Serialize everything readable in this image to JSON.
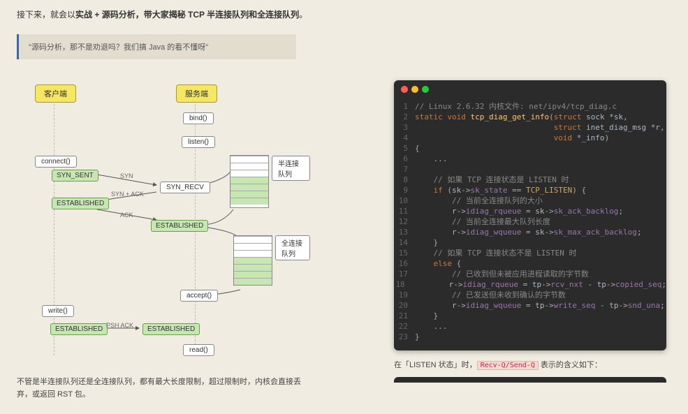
{
  "intro": {
    "prefix": "接下来，就会以",
    "emphasis": "实战 + 源码分析，带大家揭秘 TCP 半连接队列和全连接队列",
    "suffix": "。"
  },
  "quote": "\"源码分析，那不是劝退吗？我们搞 Java 的看不懂呀\"",
  "diagram": {
    "client": "客户端",
    "server": "服务端",
    "bind": "bind()",
    "listen": "listen()",
    "connect": "connect()",
    "syn_sent": "SYN_SENT",
    "syn_recv": "SYN_RECV",
    "established1": "ESTABLISHED",
    "established2": "ESTABLISHED",
    "established3": "ESTABLISHED",
    "established4": "ESTABLISHED",
    "accept": "accept()",
    "write": "write()",
    "read": "read()",
    "half_queue": "半连接队列",
    "full_queue": "全连接队列",
    "syn": "SYN",
    "synack": "SYN + ACK",
    "ack": "ACK",
    "pshack": "PSH ACK"
  },
  "bottom_left": "不管是半连接队列还是全连接队列，都有最大长度限制，超过限制时，内核会直接丢弃，或返回 RST 包。",
  "code": {
    "lines": [
      {
        "n": "1",
        "h": "<span class='c-comment'>// Linux 2.6.32 内核文件: net/ipv4/tcp_diag.c</span>"
      },
      {
        "n": "2",
        "h": "<span class='c-keyword'>static</span> <span class='c-keyword'>void</span> <span class='c-func'>tcp_diag_get_info</span>(<span class='c-struct'>struct</span> <span class='c-type'>sock</span> *<span class='c-var'>sk</span>,"
      },
      {
        "n": "3",
        "h": "                              <span class='c-struct'>struct</span> <span class='c-type'>inet_diag_msg</span> *<span class='c-var'>r</span>,"
      },
      {
        "n": "4",
        "h": "                              <span class='c-keyword'>void</span> *<span class='c-var'>_info</span>)"
      },
      {
        "n": "5",
        "h": "{"
      },
      {
        "n": "6",
        "h": "    ..."
      },
      {
        "n": "7",
        "h": ""
      },
      {
        "n": "8",
        "h": "    <span class='c-comment'>// 如果 TCP 连接状态是 LISTEN 时</span>"
      },
      {
        "n": "9",
        "h": "    <span class='c-keyword'>if</span> (<span class='c-var'>sk</span>-&gt;<span class='c-member'>sk_state</span> == <span class='c-enum'>TCP_LISTEN</span>) {"
      },
      {
        "n": "10",
        "h": "        <span class='c-comment'>// 当前全连接队列的大小</span>"
      },
      {
        "n": "11",
        "h": "        <span class='c-var'>r</span>-&gt;<span class='c-member'>idiag_rqueue</span> = <span class='c-var'>sk</span>-&gt;<span class='c-member'>sk_ack_backlog</span>;"
      },
      {
        "n": "12",
        "h": "        <span class='c-comment'>// 当前全连接最大队列长度</span>"
      },
      {
        "n": "13",
        "h": "        <span class='c-var'>r</span>-&gt;<span class='c-member'>idiag_wqueue</span> = <span class='c-var'>sk</span>-&gt;<span class='c-member'>sk_max_ack_backlog</span>;"
      },
      {
        "n": "14",
        "h": "    }"
      },
      {
        "n": "15",
        "h": "    <span class='c-comment'>// 如果 TCP 连接状态不是 LISTEN 时</span>"
      },
      {
        "n": "16",
        "h": "    <span class='c-keyword'>else</span> {"
      },
      {
        "n": "17",
        "h": "        <span class='c-comment'>// 已收到但未被应用进程读取的字节数</span>"
      },
      {
        "n": "18",
        "h": "        <span class='c-var'>r</span>-&gt;<span class='c-member'>idiag_rqueue</span> = <span class='c-var'>tp</span>-&gt;<span class='c-member'>rcv_nxt</span> - <span class='c-var'>tp</span>-&gt;<span class='c-member'>copied_seq</span>;"
      },
      {
        "n": "19",
        "h": "        <span class='c-comment'>// 已发送但未收到确认的字节数</span>"
      },
      {
        "n": "20",
        "h": "        <span class='c-var'>r</span>-&gt;<span class='c-member'>idiag_wqueue</span> = <span class='c-var'>tp</span>-&gt;<span class='c-member'>write_seq</span> - <span class='c-var'>tp</span>-&gt;<span class='c-member'>snd_una</span>;"
      },
      {
        "n": "21",
        "h": "    }"
      },
      {
        "n": "22",
        "h": "    ..."
      },
      {
        "n": "23",
        "h": "}"
      }
    ]
  },
  "right_bottom": {
    "prefix": "在「LISTEN 状态」时，",
    "code": "Recv-Q/Send-Q",
    "suffix": " 表示的含义如下："
  }
}
